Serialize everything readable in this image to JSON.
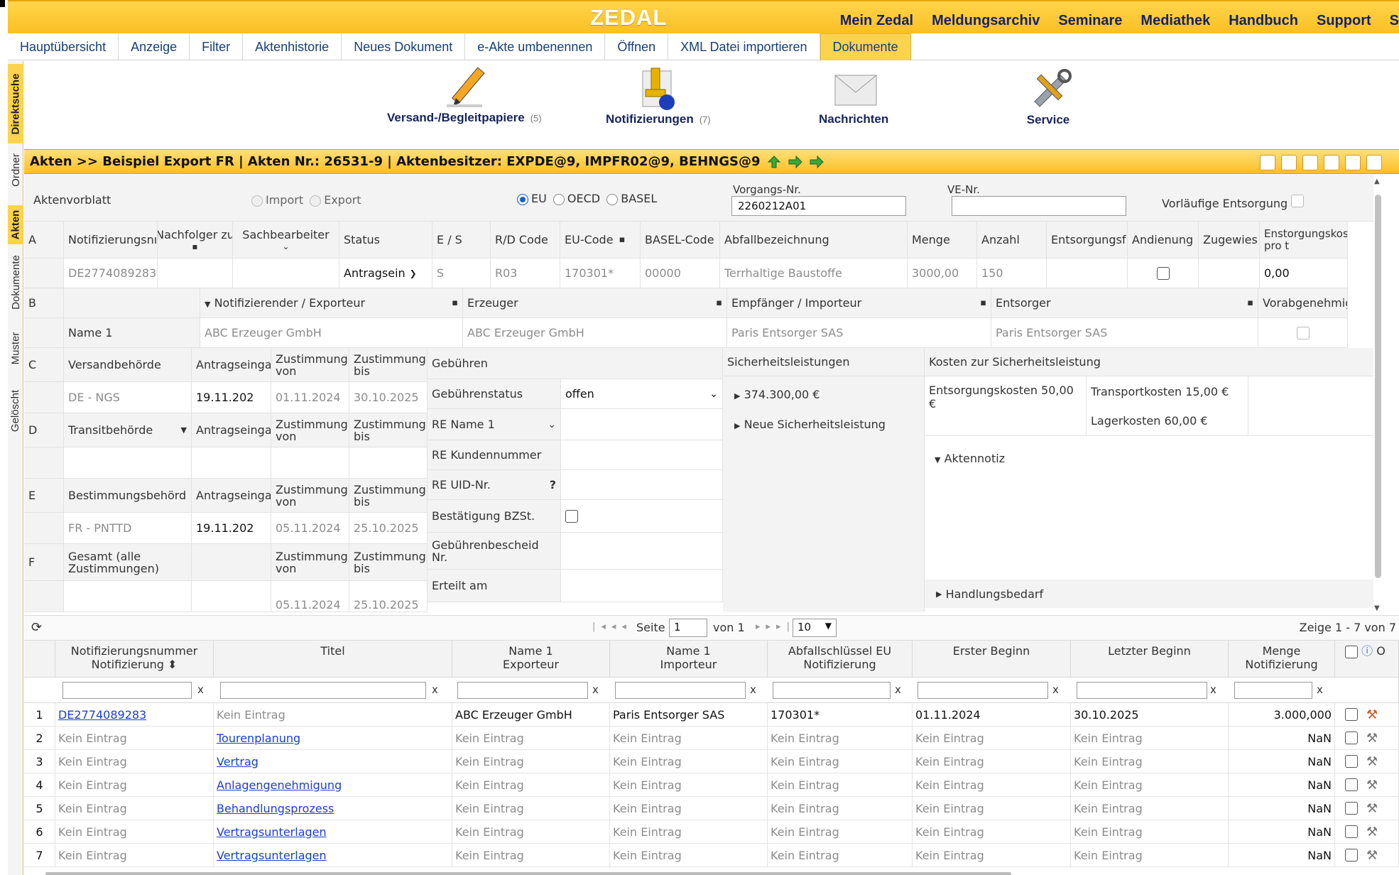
{
  "header": {
    "logo": "ZEDAL",
    "nav": [
      "Mein Zedal",
      "Meldungsarchiv",
      "Seminare",
      "Mediathek",
      "Handbuch",
      "Support",
      "S"
    ]
  },
  "tabs": [
    "Hauptübersicht",
    "Anzeige",
    "Filter",
    "Aktenhistorie",
    "Neues Dokument",
    "e-Akte umbenennen",
    "Öffnen",
    "XML Datei importieren",
    "Dokumente"
  ],
  "active_tab": "Dokumente",
  "side_tabs": [
    "Direktsuche",
    "Ordner",
    "Akten",
    "Dokumente",
    "Muster",
    "Gelöscht"
  ],
  "toolbar": [
    {
      "label": "Versand-/Begleitpapiere",
      "count": "(5)",
      "icon": "pencil-icon"
    },
    {
      "label": "Notifizierungen",
      "count": "(7)",
      "icon": "stamp-icon"
    },
    {
      "label": "Nachrichten",
      "count": "",
      "icon": "envelope-icon"
    },
    {
      "label": "Service",
      "count": "",
      "icon": "tools-icon"
    }
  ],
  "akte": {
    "title": "Akten >> Beispiel Export FR | Akten Nr.: 26531-9 | Aktenbesitzer: EXPDE@9, IMPFR02@9, BEHNGS@9"
  },
  "vorblatt": {
    "label": "Aktenvorblatt",
    "import": "Import",
    "export": "Export",
    "eu": "EU",
    "oecd": "OECD",
    "basel": "BASEL",
    "vorgang_label": "Vorgangs-Nr.",
    "vorgang_value": "2260212A01",
    "ve_label": "VE-Nr.",
    "ve_value": "",
    "vorl": "Vorläufige Entsorgung"
  },
  "rowA": {
    "letter": "A",
    "headers": [
      "Notifizierungsnı",
      "Nachfolger zu",
      "Sachbearbeiter",
      "Status",
      "E / S",
      "R/D Code",
      "EU-Code",
      "BASEL-Code",
      "Abfallbezeichnung",
      "Menge",
      "Anzahl",
      "Entsorgungsf",
      "Andienung",
      "Zugewies",
      "Enstorgungskos pro t"
    ],
    "values": [
      "DE2774089283",
      "",
      "",
      "Antragsein",
      "S",
      "R03",
      "170301*",
      "00000",
      "Terrhaltige Baustoffe",
      "3000,00",
      "150",
      "",
      "",
      "",
      "0,00"
    ]
  },
  "rowB": {
    "letter": "B",
    "headers": [
      "Notifizierender / Exporteur",
      "Erzeuger",
      "Empfänger / Importeur",
      "Entsorger",
      "Vorabgenehmigun"
    ],
    "label": "Name 1",
    "values": [
      "ABC Erzeuger GmbH",
      "ABC Erzeuger GmbH",
      "Paris Entsorger SAS",
      "Paris Entsorger SAS"
    ]
  },
  "rowC": {
    "letter": "C",
    "h1": "Versandbehörde",
    "h2": "Antragseinga",
    "h3": "Zustimmung von",
    "h4": "Zustimmung bis",
    "v1": "DE - NGS",
    "v2": "19.11.202",
    "v3": "01.11.2024",
    "v4": "30.10.2025"
  },
  "rowD": {
    "letter": "D",
    "h1": "Transitbehörde",
    "h2": "Antragseinga",
    "h3": "Zustimmung von",
    "h4": "Zustimmung bis"
  },
  "rowE": {
    "letter": "E",
    "h1": "Bestimmungsbehörd",
    "h2": "Antragseinga",
    "h3": "Zustimmung von",
    "h4": "Zustimmung bis",
    "v1": "FR - PNTTD",
    "v2": "19.11.202",
    "v3": "05.11.2024",
    "v4": "25.10.2025"
  },
  "rowF": {
    "letter": "F",
    "h1": "Gesamt (alle Zustimmungen)",
    "h3": "Zustimmung von",
    "h4": "Zustimmung bis",
    "v3": "05.11.2024",
    "v4": "25.10.2025"
  },
  "gebuehren": {
    "title": "Gebühren",
    "status_label": "Gebührenstatus",
    "status_value": "offen",
    "re_name": "RE Name 1",
    "re_kunde": "RE Kundennummer",
    "re_uid": "RE UID-Nr.",
    "bzst": "Bestätigung BZSt.",
    "bescheid": "Gebührenbescheid Nr.",
    "erteilt": "Erteilt am"
  },
  "sicherheit": {
    "title": "Sicherheitsleistungen",
    "amount": "374.300,00 €",
    "neu": "Neue Sicherheitsleistung"
  },
  "kosten": {
    "title": "Kosten zur Sicherheitsleistung",
    "entsorgung": "Entsorgungskosten 50,00 €",
    "transport": "Transportkosten 15,00 €",
    "lager": "Lagerkosten 60,00 €"
  },
  "notiz": {
    "aktennotiz": "Aktennotiz",
    "handlung": "Handlungsbedarf"
  },
  "pager": {
    "seite": "Seite",
    "page": "1",
    "von": "von 1",
    "size": "10",
    "summary": "Zeige 1 - 7 von 7"
  },
  "grid": {
    "columns": [
      {
        "l1": "Notifizierungsnummer",
        "l2": "Notifizierung ⬍"
      },
      {
        "l1": "Titel",
        "l2": ""
      },
      {
        "l1": "Name 1",
        "l2": "Exporteur"
      },
      {
        "l1": "Name 1",
        "l2": "Importeur"
      },
      {
        "l1": "Abfallschlüssel EU",
        "l2": "Notifizierung"
      },
      {
        "l1": "Erster Beginn",
        "l2": ""
      },
      {
        "l1": "Letzter Beginn",
        "l2": ""
      },
      {
        "l1": "Menge",
        "l2": "Notifizierung"
      }
    ],
    "op_label": "O",
    "rows": [
      [
        "1",
        "DE2774089283",
        "Kein Eintrag",
        "ABC Erzeuger GmbH",
        "Paris Entsorger SAS",
        "170301*",
        "01.11.2024",
        "30.10.2025",
        "3.000,000"
      ],
      [
        "2",
        "Kein Eintrag",
        "Tourenplanung",
        "Kein Eintrag",
        "Kein Eintrag",
        "Kein Eintrag",
        "Kein Eintrag",
        "Kein Eintrag",
        "NaN"
      ],
      [
        "3",
        "Kein Eintrag",
        "Vertrag",
        "Kein Eintrag",
        "Kein Eintrag",
        "Kein Eintrag",
        "Kein Eintrag",
        "Kein Eintrag",
        "NaN"
      ],
      [
        "4",
        "Kein Eintrag",
        "Anlagengenehmigung",
        "Kein Eintrag",
        "Kein Eintrag",
        "Kein Eintrag",
        "Kein Eintrag",
        "Kein Eintrag",
        "NaN"
      ],
      [
        "5",
        "Kein Eintrag",
        "Behandlungsprozess",
        "Kein Eintrag",
        "Kein Eintrag",
        "Kein Eintrag",
        "Kein Eintrag",
        "Kein Eintrag",
        "NaN"
      ],
      [
        "6",
        "Kein Eintrag",
        "Vertragsunterlagen",
        "Kein Eintrag",
        "Kein Eintrag",
        "Kein Eintrag",
        "Kein Eintrag",
        "Kein Eintrag",
        "NaN"
      ],
      [
        "7",
        "Kein Eintrag",
        "Vertragsunterlagen",
        "Kein Eintrag",
        "Kein Eintrag",
        "Kein Eintrag",
        "Kein Eintrag",
        "Kein Eintrag",
        "NaN"
      ]
    ]
  },
  "colors": {
    "accent": "#fbbf24",
    "nav": "#15235f",
    "link": "#1a3fd0"
  }
}
